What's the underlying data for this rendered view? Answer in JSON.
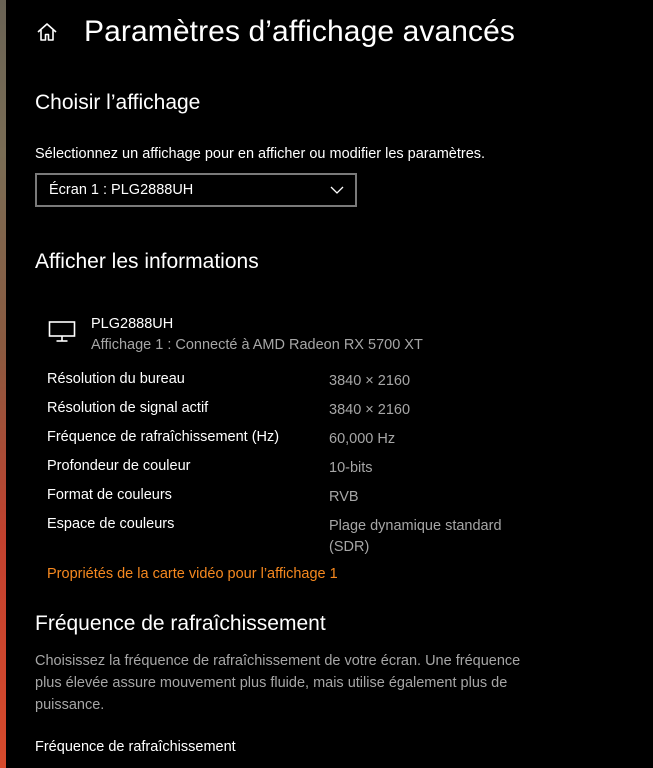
{
  "header": {
    "title": "Paramètres d’affichage avancés",
    "home_icon": "home-icon"
  },
  "choose_display": {
    "heading": "Choisir l’affichage",
    "description": "Sélectionnez un affichage pour en afficher ou modifier les paramètres.",
    "dropdown_value": "Écran 1 : PLG2888UH"
  },
  "display_info": {
    "heading": "Afficher les informations",
    "monitor_icon": "monitor-icon",
    "name": "PLG2888UH",
    "subtitle": "Affichage 1 : Connecté à AMD Radeon RX 5700 XT",
    "rows": [
      {
        "label": "Résolution du bureau",
        "value": "3840 × 2160"
      },
      {
        "label": "Résolution de signal actif",
        "value": "3840 × 2160"
      },
      {
        "label": "Fréquence de rafraîchissement (Hz)",
        "value": "60,000 Hz"
      },
      {
        "label": "Profondeur de couleur",
        "value": "10-bits"
      },
      {
        "label": "Format de couleurs",
        "value": "RVB"
      },
      {
        "label": "Espace de couleurs",
        "value": "Plage dynamique standard (SDR)"
      }
    ],
    "link": "Propriétés de la carte vidéo pour l’affichage 1"
  },
  "refresh": {
    "heading": "Fréquence de rafraîchissement",
    "description": "Choisissez la fréquence de rafraîchissement de votre écran. Une fréquence plus élevée assure mouvement plus fluide, mais utilise également plus de puissance.",
    "field_label": "Fréquence de rafraîchissement"
  },
  "colors": {
    "background": "#000000",
    "text": "#ffffff",
    "secondary_text": "#a6a6a6",
    "accent_link": "#f7891f",
    "dropdown_border": "#7a7a7a"
  }
}
